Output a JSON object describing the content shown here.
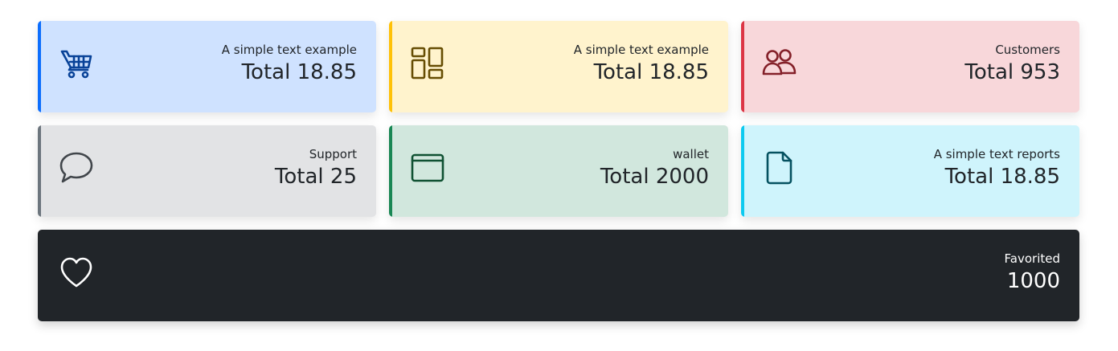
{
  "cards": [
    {
      "label": "A simple text example",
      "value": "Total 18.85",
      "icon": "cart-icon",
      "color": "#084298",
      "accent": "#0d6efd",
      "background": "#cfe2ff"
    },
    {
      "label": "A simple text example",
      "value": "Total 18.85",
      "icon": "dashboard-icon",
      "color": "#664d03",
      "accent": "#ffc107",
      "background": "#fff3cd"
    },
    {
      "label": "Customers",
      "value": "Total 953",
      "icon": "people-icon",
      "color": "#842029",
      "accent": "#dc3545",
      "background": "#f8d7da"
    },
    {
      "label": "Support",
      "value": "Total 25",
      "icon": "chat-icon",
      "color": "#41464b",
      "accent": "#6c757d",
      "background": "#e2e3e5"
    },
    {
      "label": "wallet",
      "value": "Total 2000",
      "icon": "wallet-icon",
      "color": "#0f5132",
      "accent": "#198754",
      "background": "#d1e7dd"
    },
    {
      "label": "A simple text reports",
      "value": "Total 18.85",
      "icon": "file-icon",
      "color": "#055160",
      "accent": "#0dcaf0",
      "background": "#cff4fc"
    },
    {
      "label": "Favorited",
      "value": "1000",
      "icon": "heart-icon",
      "color": "#ffffff",
      "accent": "#212529",
      "background": "#212529"
    }
  ]
}
